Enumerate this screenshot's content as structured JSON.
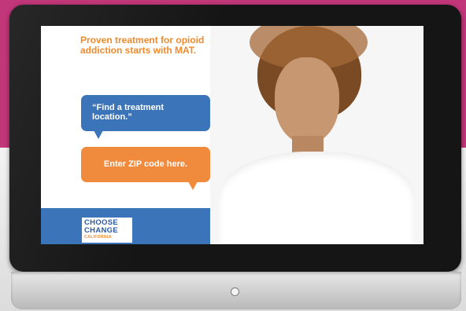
{
  "background": {
    "top_color": "#c2367a",
    "bottom_color": "#e6e6e6"
  },
  "ad": {
    "eyebrow": "",
    "headline": "Proven treatment for opioid addiction starts with MAT.",
    "body": "",
    "speech_bubble_1": "“Find a treatment\nlocation.”",
    "speech_bubble_2": "Enter ZIP code here.",
    "logo": {
      "line1": "CHOOSE",
      "line2": "CHANGE",
      "line3": "CALIFORNIA"
    },
    "colors": {
      "orange": "#f08a3c",
      "blue": "#3c74b9"
    }
  },
  "device": {
    "power_button_icon": "power-icon"
  }
}
